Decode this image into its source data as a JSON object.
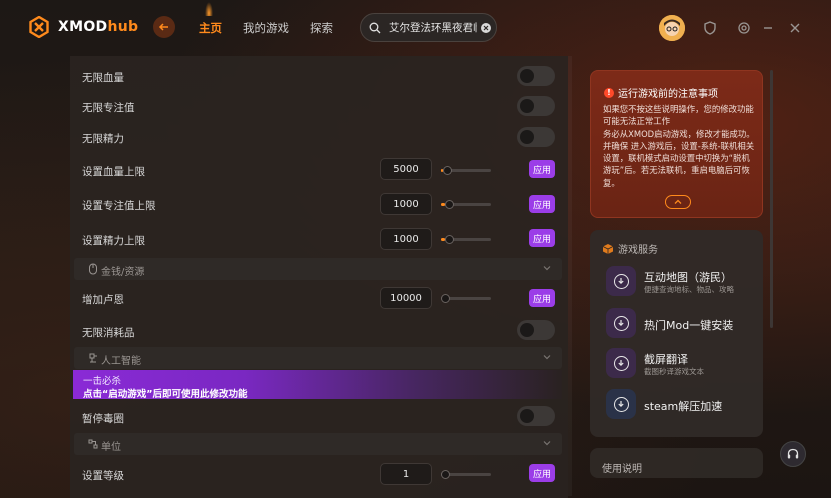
{
  "app": {
    "logo_text_main": "XMOD",
    "logo_text_accent": "hub"
  },
  "nav": {
    "home": "主页",
    "my_games": "我的游戏",
    "explore": "探索"
  },
  "search": {
    "value": "艾尔登法环黑夜君临"
  },
  "settings": {
    "rows": [
      {
        "label": "无限血量",
        "type": "toggle",
        "on": false
      },
      {
        "label": "无限专注值",
        "type": "toggle",
        "on": false
      },
      {
        "label": "无限精力",
        "type": "toggle",
        "on": false
      },
      {
        "label": "设置血量上限",
        "type": "number",
        "value": "5000",
        "apply": "应用"
      },
      {
        "label": "设置专注值上限",
        "type": "number",
        "value": "1000",
        "apply": "应用"
      },
      {
        "label": "设置精力上限",
        "type": "number",
        "value": "1000",
        "apply": "应用"
      }
    ],
    "section_money": "金钱/资源",
    "money_rows": [
      {
        "label": "增加卢恩",
        "type": "number",
        "value": "10000",
        "apply": "应用"
      },
      {
        "label": "无限消耗品",
        "type": "toggle",
        "on": false
      }
    ],
    "section_ai": "人工智能",
    "promo": {
      "line1": "一击必杀",
      "line2": "点击“启动游戏”后即可使用此修改功能"
    },
    "ai_rows": [
      {
        "label": "暂停毒圈",
        "type": "toggle",
        "on": false
      }
    ],
    "section_unit": "单位",
    "unit_rows": [
      {
        "label": "设置等级",
        "type": "number",
        "value": "1",
        "apply": "应用"
      }
    ]
  },
  "notice": {
    "title": "运行游戏前的注意事项",
    "body": "如果您不按这些说明操作，您的修改功能可能无法正常工作\n务必从XMOD启动游戏，修改才能成功。\n并确保 进入游戏后，设置-系统-联机相关设置，联机模式启动设置中切换为“脱机游玩”后。若无法联机，重启电脑后可恢复。"
  },
  "services": {
    "title": "游戏服务",
    "items": [
      {
        "title": "互动地图（游民）",
        "subtitle": "便捷查询地标、物品、攻略"
      },
      {
        "title": "热门Mod一键安装",
        "subtitle": ""
      },
      {
        "title": "截屏翻译",
        "subtitle": "截图秒译游戏文本"
      },
      {
        "title": "steam解压加速",
        "subtitle": ""
      }
    ]
  },
  "usage": {
    "title": "使用说明"
  },
  "colors": {
    "accent": "#ff8a1c",
    "apply_button": "#9b3de8",
    "notice_bg": "#7d2a18"
  }
}
